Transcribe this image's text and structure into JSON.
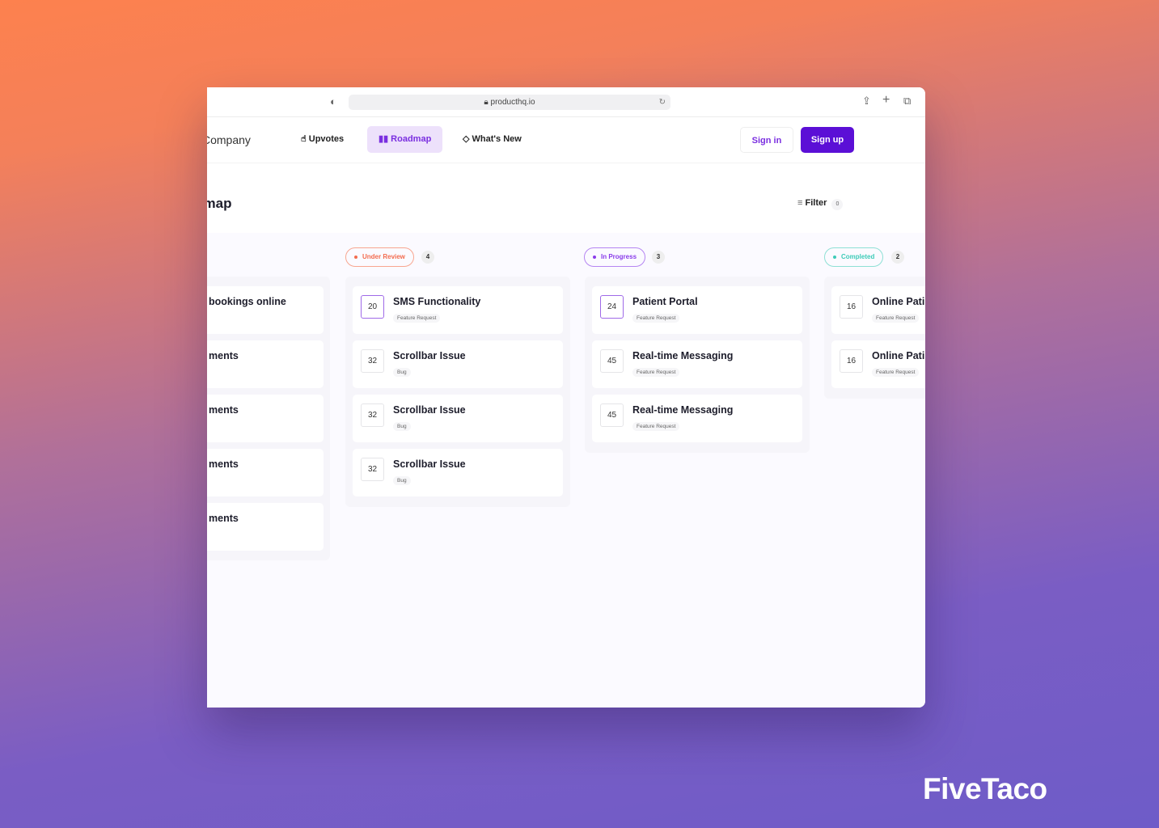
{
  "browser": {
    "url": "producthq.io"
  },
  "nav": {
    "brand": "Company",
    "items": [
      {
        "label": "Upvotes",
        "icon": "thumbs-up-icon"
      },
      {
        "label": "Roadmap",
        "icon": "roadmap-icon"
      },
      {
        "label": "What's New",
        "icon": "diamond-icon"
      }
    ],
    "sign_in": "Sign in",
    "sign_up": "Sign up"
  },
  "page": {
    "title": "Roadmap",
    "filter": "Filter",
    "filter_count": "0"
  },
  "colors": {
    "accent": "#5b0fd6",
    "under_review": "#f36c4f",
    "in_progress": "#8a3cea",
    "completed": "#3ecbb8"
  },
  "columns": [
    {
      "cards": [
        {
          "title": "bookings online"
        },
        {
          "title": "ments"
        },
        {
          "title": "ments"
        },
        {
          "title": "ments"
        },
        {
          "title": "ments"
        }
      ]
    },
    {
      "status": "Under Review",
      "count": "4",
      "cards": [
        {
          "votes": "20",
          "title": "SMS Functionality",
          "tag": "Feature Request"
        },
        {
          "votes": "32",
          "title": "Scrollbar Issue",
          "tag": "Bug"
        },
        {
          "votes": "32",
          "title": "Scrollbar Issue",
          "tag": "Bug"
        },
        {
          "votes": "32",
          "title": "Scrollbar Issue",
          "tag": "Bug"
        }
      ]
    },
    {
      "status": "In Progress",
      "count": "3",
      "cards": [
        {
          "votes": "24",
          "title": "Patient Portal",
          "tag": "Feature Request"
        },
        {
          "votes": "45",
          "title": "Real-time Messaging",
          "tag": "Feature Request"
        },
        {
          "votes": "45",
          "title": "Real-time Messaging",
          "tag": "Feature Request"
        }
      ]
    },
    {
      "status": "Completed",
      "count": "2",
      "cards": [
        {
          "votes": "16",
          "title": "Online Pati",
          "tag": "Feature Request"
        },
        {
          "votes": "16",
          "title": "Online Pati",
          "tag": "Feature Request"
        }
      ]
    }
  ],
  "watermark": "FiveTaco"
}
